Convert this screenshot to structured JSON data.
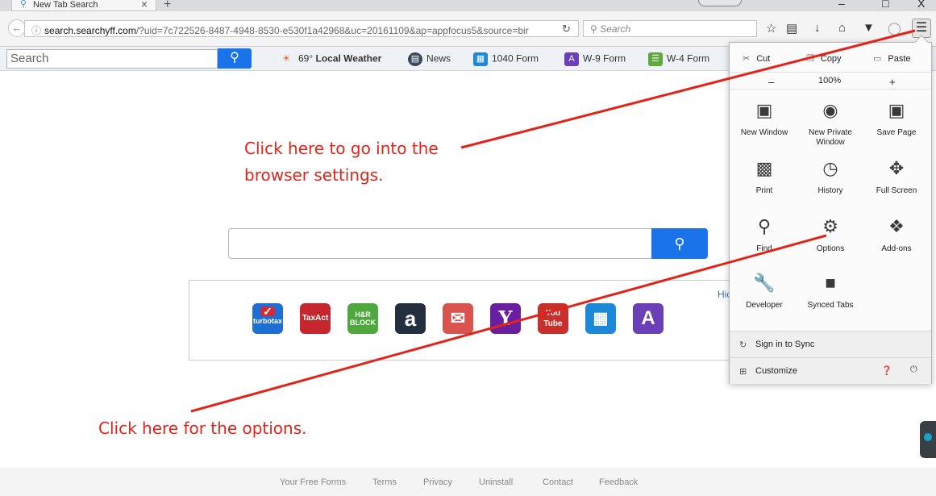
{
  "tab": {
    "title": "New Tab Search",
    "close": "×",
    "new_tab": "+"
  },
  "window": {
    "minimize": "–",
    "maximize": "□",
    "close": "X"
  },
  "navbar": {
    "url_domain": "search.searchyff.com",
    "url_rest": "/?uid=7c722526-8487-4948-8530-e530f1a42968&uc=20161109&ap=appfocus5&source=bir",
    "search_placeholder": "Search"
  },
  "toolbar": {
    "search_placeholder": "Search",
    "weather_temp": "69°",
    "weather_label": "Local Weather",
    "items": [
      {
        "label": "News",
        "icon": "news-icon",
        "color": "#3a4a5a"
      },
      {
        "label": "1040 Form",
        "icon": "bank-icon",
        "color": "#1e88d8"
      },
      {
        "label": "W-9 Form",
        "icon": "letter-a-icon",
        "color": "#6b3fb5"
      },
      {
        "label": "W-4 Form",
        "icon": "document-icon",
        "color": "#5fa83b"
      }
    ]
  },
  "annotations": {
    "settings_line1": "Click here to go into the",
    "settings_line2": "browser settings.",
    "options": "Click here for the options."
  },
  "quicklinks": {
    "hide_label": "Hic",
    "items": [
      {
        "name": "turbotax",
        "text": "turbotax",
        "color": "#1d6fd6"
      },
      {
        "name": "taxact",
        "text": "TaxAct",
        "color": "#c6262e"
      },
      {
        "name": "hr-block",
        "text": "H&R BLOCK",
        "color": "#4fa83d"
      },
      {
        "name": "amazon",
        "text": "a",
        "color": "#232f3e"
      },
      {
        "name": "gmail",
        "text": "✉",
        "color": "#d9534f"
      },
      {
        "name": "yahoo",
        "text": "Y",
        "color": "#6a1fa0"
      },
      {
        "name": "youtube",
        "text": "You Tube",
        "color": "#c8302b"
      },
      {
        "name": "bank",
        "text": "🏛",
        "color": "#1e88d8"
      },
      {
        "name": "letter-a",
        "text": "A",
        "color": "#6b3fb5"
      }
    ]
  },
  "menu": {
    "cut": "Cut",
    "copy": "Copy",
    "paste": "Paste",
    "zoom_out": "–",
    "zoom": "100%",
    "zoom_in": "+",
    "items": {
      "new_window": "New Window",
      "new_private_window": "New Private Window",
      "save_page": "Save Page",
      "print": "Print",
      "history": "History",
      "full_screen": "Full Screen",
      "find": "Find",
      "options": "Options",
      "addons": "Add-ons",
      "developer": "Developer",
      "synced_tabs": "Synced Tabs"
    },
    "sign_in": "Sign in to Sync",
    "customize": "Customize"
  },
  "footer": {
    "links": [
      "Your Free Forms",
      "Terms",
      "Privacy",
      "Uninstall",
      "Contact",
      "Feedback"
    ]
  },
  "colors": {
    "accent_blue": "#1a73e8",
    "annotation_red": "#e2231a"
  }
}
